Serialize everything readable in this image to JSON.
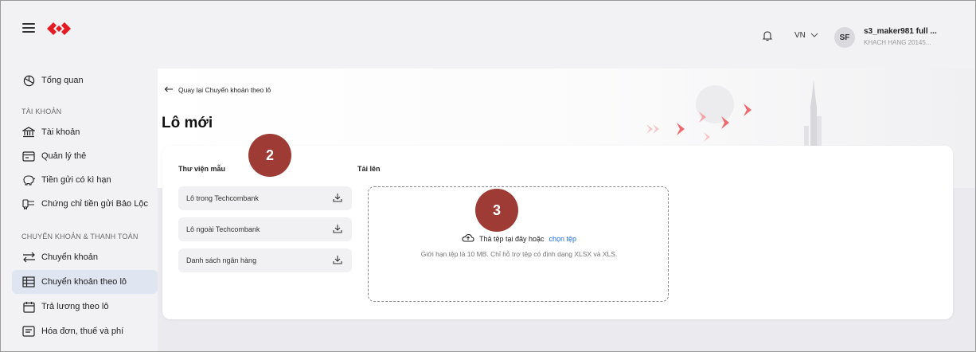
{
  "app": {
    "brand_color": "#e31b23",
    "accent": "#1a6fe0",
    "active_bg": "#dfe6f2"
  },
  "header": {
    "language": "VN",
    "avatar_initials": "SF",
    "user_name": "s3_maker981 full ...",
    "user_sub": "KHACH HANG 20145..."
  },
  "sidebar": {
    "overview": "Tổng quan",
    "section_account": "TÀI KHOẢN",
    "account": "Tài khoản",
    "cards": "Quản lý thẻ",
    "term_deposit": "Tiền gửi có kì hạn",
    "certificate": "Chứng chỉ tiền gửi Bảo Lộc",
    "section_transfer": "CHUYỂN KHOẢN & THANH TOÁN",
    "transfer": "Chuyển khoản",
    "batch_transfer": "Chuyển khoản theo lô",
    "batch_payroll": "Trả lương theo lô",
    "bills": "Hóa đơn, thuế và phí"
  },
  "page": {
    "back_label": "Quay lại Chuyển khoản theo lô",
    "title": "Lô mới"
  },
  "library": {
    "title": "Thư viện mẫu",
    "items": [
      "Lô trong Techcombank",
      "Lô ngoài Techcombank",
      "Danh sách ngân hàng"
    ]
  },
  "upload": {
    "title": "Tải lên",
    "drop_text": "Thả tệp tại đây hoặc",
    "choose_link": "chọn tệp",
    "hint": "Giới hạn tệp là 10 MB. Chỉ hỗ trợ tệp có định dạng XLSX và XLS."
  },
  "annotations": {
    "step_library": "2",
    "step_upload": "3"
  }
}
